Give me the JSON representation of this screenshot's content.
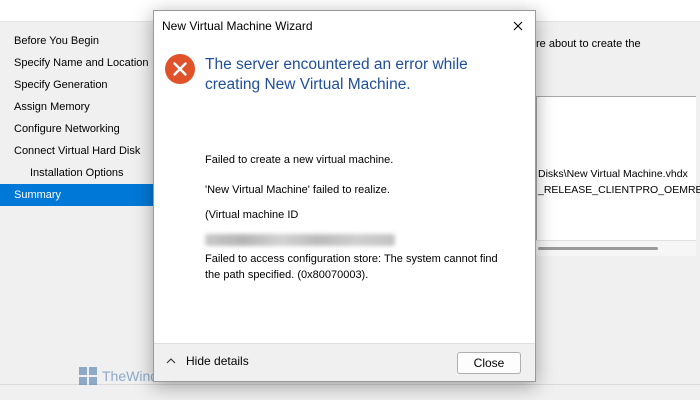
{
  "background_wizard": {
    "nav_items": [
      {
        "label": "Before You Begin"
      },
      {
        "label": "Specify Name and Location"
      },
      {
        "label": "Specify Generation"
      },
      {
        "label": "Assign Memory"
      },
      {
        "label": "Configure Networking"
      },
      {
        "label": "Connect Virtual Hard Disk"
      },
      {
        "label": "Installation Options"
      },
      {
        "label": "Summary"
      }
    ],
    "selected_item": "Summary",
    "right_text": "re about to create the",
    "summary_lines": [
      "Disks\\New Virtual Machine.vhdx",
      "_RELEASE_CLIENTPRO_OEMRE"
    ]
  },
  "dialog": {
    "title": "New Virtual Machine Wizard",
    "heading": "The server encountered an error while creating New Virtual Machine.",
    "details": {
      "line1": "Failed to create a new virtual machine.",
      "line2": "'New Virtual Machine' failed to realize.",
      "line3": "(Virtual machine ID",
      "line4": "Failed to access configuration store: The system cannot find the path specified. (0x80070003)."
    },
    "footer": {
      "hide_details_label": "Hide details",
      "close_label": "Close"
    }
  },
  "watermark": {
    "text": "TheWindowsClub"
  },
  "colors": {
    "accent": "#0078d7",
    "heading_blue": "#1f4e9c",
    "error_orange": "#e0532a"
  }
}
